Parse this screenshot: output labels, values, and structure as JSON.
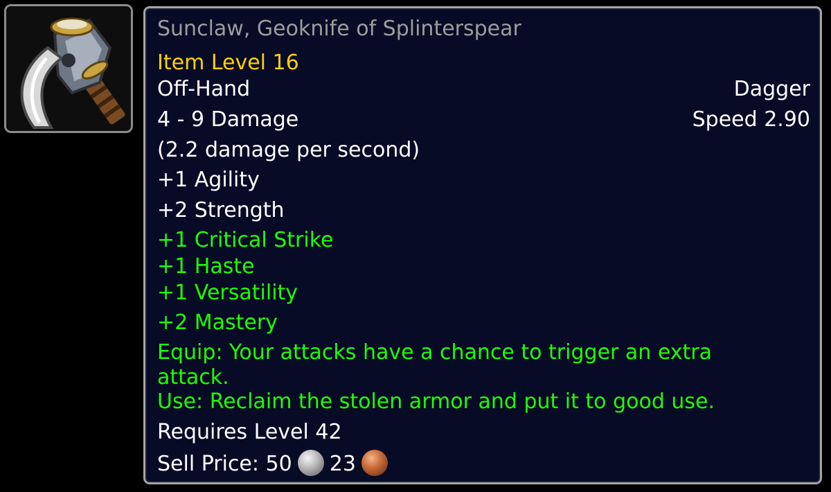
{
  "item": {
    "icon": "dagger-icon",
    "name": "Sunclaw, Geoknife of Splinterspear",
    "item_level": "Item Level 16",
    "slot": "Off-Hand",
    "type": "Dagger",
    "damage": "4 - 9 Damage",
    "speed": "Speed 2.90",
    "dps": "(2.2 damage per second)",
    "primary_stats": [
      "+1 Agility",
      "+2 Strength"
    ],
    "secondary_stats": [
      "+1 Critical Strike",
      "+1 Haste",
      "+1 Versatility",
      "+2 Mastery"
    ],
    "equip_effect": "Equip: Your attacks have a chance to trigger an extra attack.",
    "use_effect": "Use: Reclaim the stolen armor and put it to good use.",
    "requirement": "Requires Level 42",
    "sell_price": {
      "label": "Sell Price:",
      "silver": "50",
      "copper": "23"
    }
  },
  "colors": {
    "name": "#9d9d9d",
    "item_level": "#ffd100",
    "bonus": "#1eff00",
    "text": "#ffffff",
    "background": "#070b26",
    "border": "#a5a5a5"
  }
}
